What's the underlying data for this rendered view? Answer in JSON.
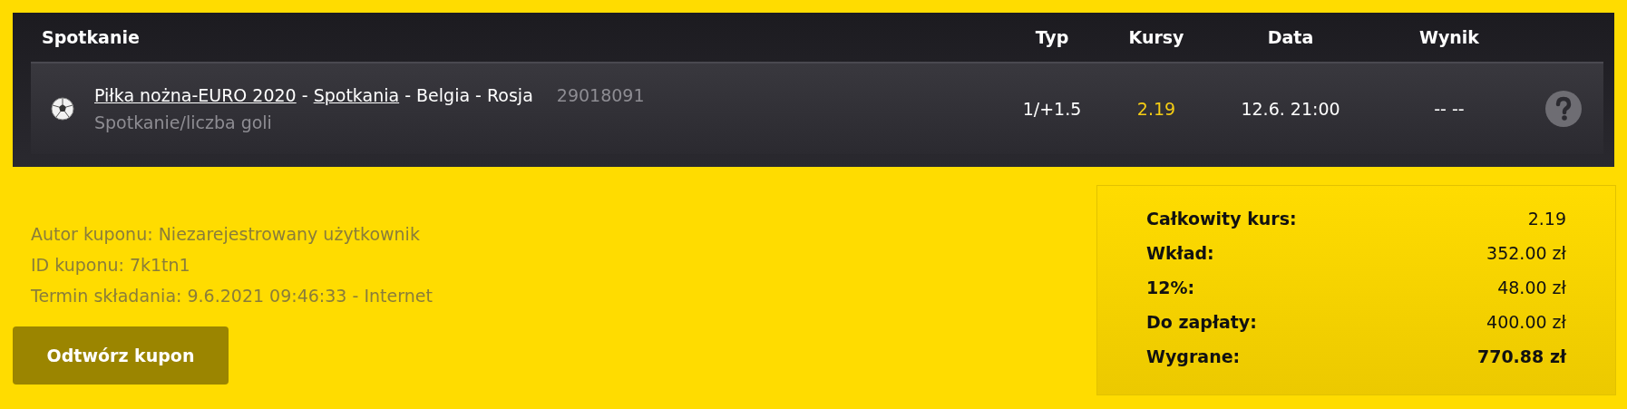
{
  "table": {
    "columns": [
      "Spotkanie",
      "Typ",
      "Kursy",
      "Data",
      "Wynik"
    ],
    "rows": [
      {
        "match_parts": [
          {
            "kind": "link",
            "text": "Piłka nożna-EURO 2020"
          },
          {
            "kind": "plain",
            "text": " - "
          },
          {
            "kind": "link",
            "text": "Spotkania"
          },
          {
            "kind": "plain",
            "text": " - Belgia - Rosja"
          }
        ],
        "event_id": "29018091",
        "market": "Spotkanie/liczba goli",
        "type": "1/+1.5",
        "odds": "2.19",
        "date": "12.6. 21:00",
        "result": "-- --"
      }
    ]
  },
  "coupon_info": [
    "Autor kuponu: Niezarejestrowany użytkownik",
    "ID kuponu: 7k1tn1",
    "Termin składania: 9.6.2021 09:46:33 - Internet"
  ],
  "reopen_button": "Odtwórz kupon",
  "summary": [
    {
      "label": "Całkowity kurs:",
      "value": "2.19",
      "bold": false
    },
    {
      "label": "Wkład:",
      "value": "352.00 zł",
      "bold": false
    },
    {
      "label": "12%:",
      "value": "48.00 zł",
      "bold": false
    },
    {
      "label": "Do zapłaty:",
      "value": "400.00 zł",
      "bold": false
    },
    {
      "label": "Wygrane:",
      "value": "770.88 zł",
      "bold": true
    }
  ]
}
